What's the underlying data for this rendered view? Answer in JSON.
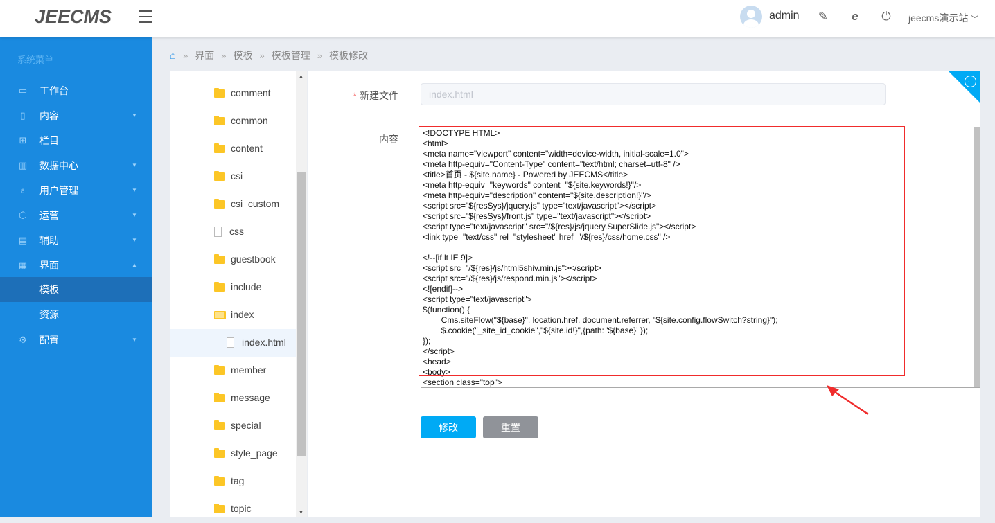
{
  "header": {
    "logo": "JEECMS",
    "user": "admin",
    "site": "jeecms演示站"
  },
  "sidebar": {
    "title": "系统菜单",
    "items": [
      {
        "label": "工作台",
        "icon": "monitor-icon",
        "arrow": ""
      },
      {
        "label": "内容",
        "icon": "file-icon",
        "arrow": "▼"
      },
      {
        "label": "栏目",
        "icon": "grid-icon",
        "arrow": ""
      },
      {
        "label": "数据中心",
        "icon": "chart-icon",
        "arrow": "▼"
      },
      {
        "label": "用户管理",
        "icon": "user-icon",
        "arrow": "▼"
      },
      {
        "label": "运营",
        "icon": "shield-icon",
        "arrow": "▼"
      },
      {
        "label": "辅助",
        "icon": "box-icon",
        "arrow": "▼"
      },
      {
        "label": "界面",
        "icon": "layout-icon",
        "arrow": "▲"
      },
      {
        "label": "模板",
        "icon": "",
        "arrow": ""
      },
      {
        "label": "资源",
        "icon": "",
        "arrow": ""
      },
      {
        "label": "配置",
        "icon": "gear-icon",
        "arrow": "▼"
      }
    ]
  },
  "breadcrumb": [
    "界面",
    "模板",
    "模板管理",
    "模板修改"
  ],
  "tree": [
    {
      "label": "comment",
      "type": "folder"
    },
    {
      "label": "common",
      "type": "folder"
    },
    {
      "label": "content",
      "type": "folder"
    },
    {
      "label": "csi",
      "type": "folder"
    },
    {
      "label": "csi_custom",
      "type": "folder"
    },
    {
      "label": "css",
      "type": "file"
    },
    {
      "label": "guestbook",
      "type": "folder"
    },
    {
      "label": "include",
      "type": "folder"
    },
    {
      "label": "index",
      "type": "open"
    },
    {
      "label": "index.html",
      "type": "selected"
    },
    {
      "label": "member",
      "type": "folder"
    },
    {
      "label": "message",
      "type": "folder"
    },
    {
      "label": "special",
      "type": "folder"
    },
    {
      "label": "style_page",
      "type": "folder"
    },
    {
      "label": "tag",
      "type": "folder"
    },
    {
      "label": "topic",
      "type": "folder"
    }
  ],
  "form": {
    "filename_label": "新建文件",
    "filename_value": "index.html",
    "content_label": "内容",
    "content": "<!DOCTYPE HTML>\n<html>\n<meta name=\"viewport\" content=\"width=device-width, initial-scale=1.0\">\n<meta http-equiv=\"Content-Type\" content=\"text/html; charset=utf-8\" />\n<title>首页 - ${site.name} - Powered by JEECMS</title>\n<meta http-equiv=\"keywords\" content=\"${site.keywords!}\"/>\n<meta http-equiv=\"description\" content=\"${site.description!}\"/>\n<script src=\"${resSys}/jquery.js\" type=\"text/javascript\"></script>\n<script src=\"${resSys}/front.js\" type=\"text/javascript\"></script>\n<script type=\"text/javascript\" src=\"/${res}/js/jquery.SuperSlide.js\"></script>\n<link type=\"text/css\" rel=\"stylesheet\" href=\"/${res}/css/home.css\" />\n\n<!--[if lt IE 9]>\n<script src=\"/${res}/js/html5shiv.min.js\"></script>\n<script src=\"/${res}/js/respond.min.js\"></script>\n<![endif]-->\n<script type=\"text/javascript\">\n$(function() {\n        Cms.siteFlow(\"${base}\", location.href, document.referrer, \"${site.config.flowSwitch?string}\");\n        $.cookie(\"_site_id_cookie\",\"${site.id!}\",{path: '${base}' });\n});\n</script>\n<head>\n<body>\n<section class=\"top\">",
    "submit": "修改",
    "reset": "重置"
  },
  "colors": {
    "sidebar": "#1a8ae0",
    "primary": "#00aaf5",
    "annotation": "#f02c2c"
  }
}
